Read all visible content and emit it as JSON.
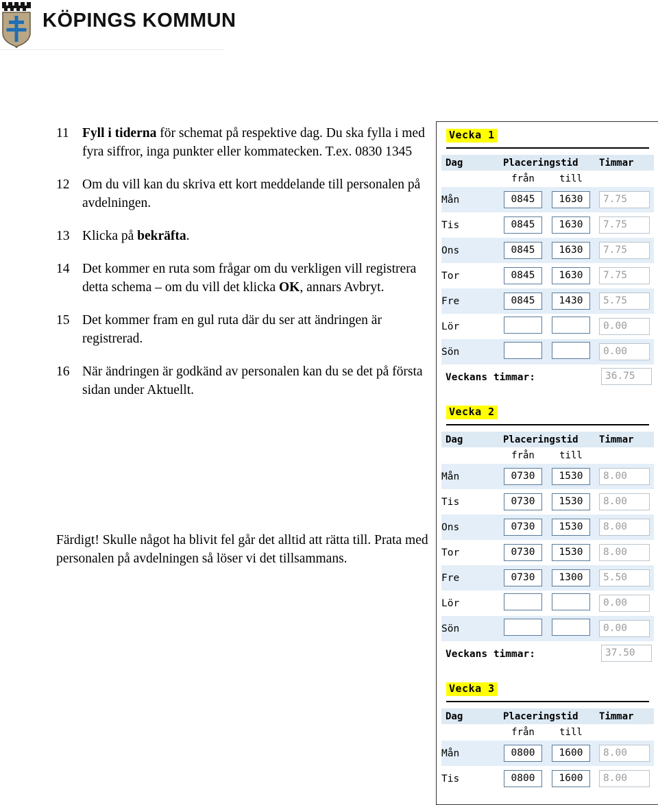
{
  "header": {
    "crest_icon": "kopings-kommun-coat-of-arms",
    "brand": "KÖPINGS KOMMUN",
    "crest_colors": {
      "shield_fill": "#b8a684",
      "shield_border": "#6b5f4a",
      "cross": "#1f6fb5",
      "battlement": "#141414"
    }
  },
  "instructions": {
    "steps": [
      {
        "number": "11",
        "parts": [
          {
            "text": "Fyll i tiderna",
            "bold": true
          },
          {
            "text": " för schemat på respektive dag. Du ska fylla i med fyra siffror, inga punkter eller kommatecken. T.ex. 0830 1345",
            "bold": false
          }
        ]
      },
      {
        "number": "12",
        "parts": [
          {
            "text": "Om du vill kan du skriva ett kort meddelande till personalen på avdelningen.",
            "bold": false
          }
        ]
      },
      {
        "number": "13",
        "parts": [
          {
            "text": "Klicka på ",
            "bold": false
          },
          {
            "text": "bekräfta",
            "bold": true
          },
          {
            "text": ".",
            "bold": false
          }
        ]
      },
      {
        "number": "14",
        "parts": [
          {
            "text": "Det kommer en ruta som frågar om du verkligen vill registrera detta schema – om du vill det klicka ",
            "bold": false
          },
          {
            "text": "OK",
            "bold": true
          },
          {
            "text": ", annars Avbryt.",
            "bold": false
          }
        ]
      },
      {
        "number": "15",
        "parts": [
          {
            "text": "Det kommer fram en gul ruta där du ser att ändringen är registrerad.",
            "bold": false
          }
        ]
      },
      {
        "number": "16",
        "parts": [
          {
            "text": "När ändringen är godkänd av personalen kan du se det på första sidan under Aktuellt.",
            "bold": false
          }
        ]
      }
    ],
    "closing": "Färdigt! Skulle något ha blivit fel går det alltid att rätta till. Prata med personalen på avdelningen så löser vi det tillsammans."
  },
  "schedule_panel": {
    "highlight_color": "#ffff00",
    "header_row_color": "#dde9f3",
    "stripe_color": "#e3eef8",
    "input_border_color": "#5a7a9a",
    "readonly_text_color": "#9b9b9b",
    "columns": {
      "day": "Dag",
      "placement": "Placeringstid",
      "hours": "Timmar",
      "from": "från",
      "to": "till"
    },
    "total_label": "Veckans timmar:",
    "weeks": [
      {
        "title": "Vecka 1",
        "rows": [
          {
            "day": "Mån",
            "from": "0845",
            "to": "1630",
            "hours": "7.75"
          },
          {
            "day": "Tis",
            "from": "0845",
            "to": "1630",
            "hours": "7.75"
          },
          {
            "day": "Ons",
            "from": "0845",
            "to": "1630",
            "hours": "7.75"
          },
          {
            "day": "Tor",
            "from": "0845",
            "to": "1630",
            "hours": "7.75"
          },
          {
            "day": "Fre",
            "from": "0845",
            "to": "1430",
            "hours": "5.75"
          },
          {
            "day": "Lör",
            "from": "",
            "to": "",
            "hours": "0.00"
          },
          {
            "day": "Sön",
            "from": "",
            "to": "",
            "hours": "0.00"
          }
        ],
        "total": "36.75"
      },
      {
        "title": "Vecka 2",
        "rows": [
          {
            "day": "Mån",
            "from": "0730",
            "to": "1530",
            "hours": "8.00"
          },
          {
            "day": "Tis",
            "from": "0730",
            "to": "1530",
            "hours": "8.00"
          },
          {
            "day": "Ons",
            "from": "0730",
            "to": "1530",
            "hours": "8.00"
          },
          {
            "day": "Tor",
            "from": "0730",
            "to": "1530",
            "hours": "8.00"
          },
          {
            "day": "Fre",
            "from": "0730",
            "to": "1300",
            "hours": "5.50"
          },
          {
            "day": "Lör",
            "from": "",
            "to": "",
            "hours": "0.00"
          },
          {
            "day": "Sön",
            "from": "",
            "to": "",
            "hours": "0.00"
          }
        ],
        "total": "37.50"
      },
      {
        "title": "Vecka 3",
        "rows": [
          {
            "day": "Mån",
            "from": "0800",
            "to": "1600",
            "hours": "8.00"
          },
          {
            "day": "Tis",
            "from": "0800",
            "to": "1600",
            "hours": "8.00"
          }
        ],
        "total": ""
      }
    ]
  }
}
